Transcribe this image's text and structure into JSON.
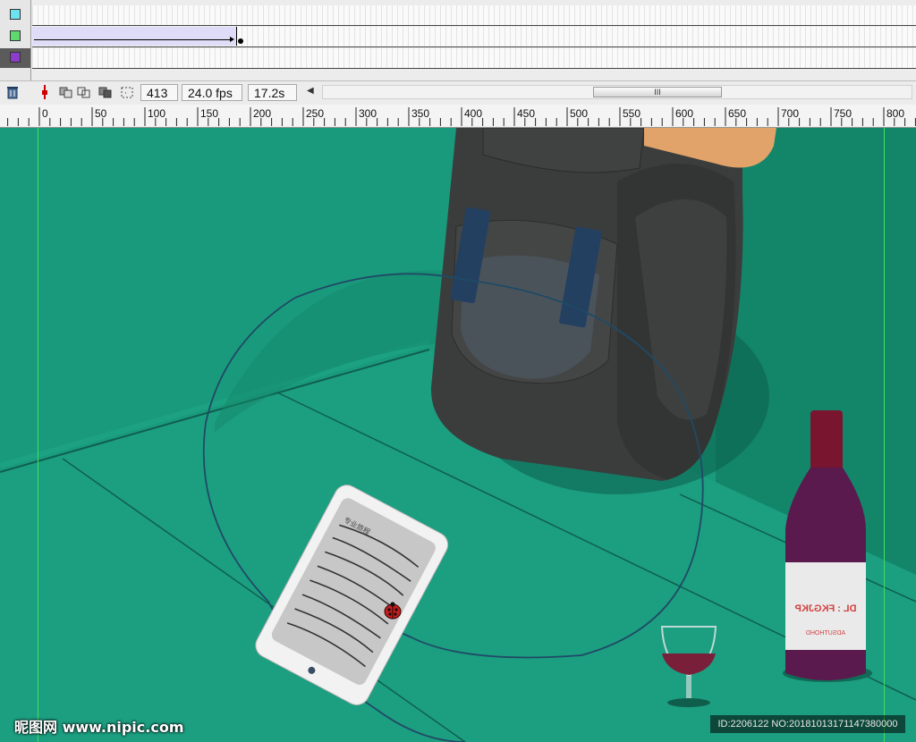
{
  "timeline": {
    "layers": [
      {
        "name": "layer-cyan",
        "color": "#6ce3f0"
      },
      {
        "name": "layer-green",
        "color": "#5fd86d"
      },
      {
        "name": "layer-purple",
        "color": "#8b3cc8"
      }
    ],
    "frame": "413",
    "fps": "24.0 fps",
    "time": "17.2s",
    "scroll_thumb": "III"
  },
  "ruler": {
    "labels": [
      "0",
      "50",
      "100",
      "150",
      "200",
      "250",
      "300",
      "350",
      "400",
      "450",
      "500",
      "550",
      "600",
      "650",
      "700",
      "750",
      "800"
    ]
  },
  "stage": {
    "background": "#1a9a7c",
    "tablet_title": "专业旅程",
    "bottle_label_main": "DL : FKGJKP",
    "bottle_label_sub": "ADSUTHOHD"
  },
  "watermark": {
    "site": "昵图网 www.nipic.com",
    "id": "ID:2206122 NO:20181013171147380000"
  }
}
